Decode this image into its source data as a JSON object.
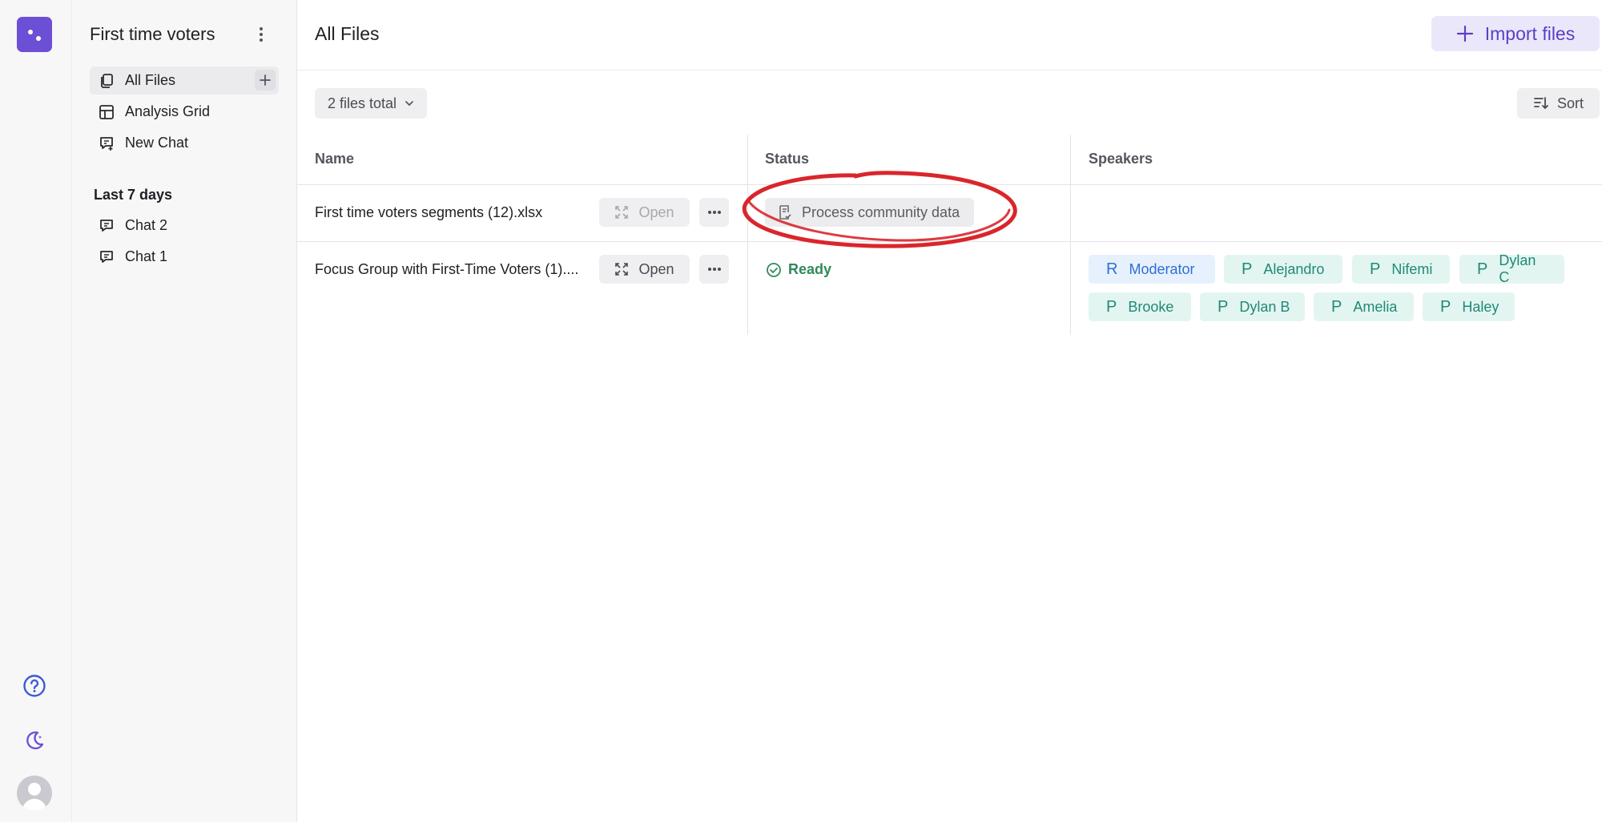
{
  "rail": {
    "icons": [
      "app-logo",
      "help-icon",
      "moon-icon",
      "user-avatar"
    ]
  },
  "sidebar": {
    "project_title": "First time voters",
    "items": [
      {
        "label": "All Files",
        "icon": "files-icon",
        "active": true
      },
      {
        "label": "Analysis Grid",
        "icon": "grid-icon",
        "active": false
      },
      {
        "label": "New Chat",
        "icon": "chat-plus-icon",
        "active": false
      }
    ],
    "section_label": "Last 7 days",
    "chats": [
      {
        "label": "Chat 2",
        "icon": "chat-icon"
      },
      {
        "label": "Chat 1",
        "icon": "chat-icon"
      }
    ]
  },
  "main": {
    "title": "All Files",
    "import_label": "Import files",
    "files_total": "2 files total",
    "sort_label": "Sort",
    "columns": {
      "name": "Name",
      "status": "Status",
      "speakers": "Speakers"
    },
    "rows": [
      {
        "name": "First time voters segments (12).xlsx",
        "open_label": "Open",
        "open_disabled": true,
        "status": "Process community data",
        "speakers": []
      },
      {
        "name": "Focus Group with First-Time Voters (1)....",
        "open_label": "Open",
        "open_disabled": false,
        "status": "Ready",
        "speakers": [
          {
            "initial": "R",
            "name": "Moderator",
            "role": "moderator"
          },
          {
            "initial": "P",
            "name": "Alejandro",
            "role": "participant"
          },
          {
            "initial": "P",
            "name": "Nifemi",
            "role": "participant"
          },
          {
            "initial": "P",
            "name": "Dylan C",
            "role": "participant"
          },
          {
            "initial": "P",
            "name": "Brooke",
            "role": "participant"
          },
          {
            "initial": "P",
            "name": "Dylan B",
            "role": "participant"
          },
          {
            "initial": "P",
            "name": "Amelia",
            "role": "participant"
          },
          {
            "initial": "P",
            "name": "Haley",
            "role": "participant"
          }
        ]
      }
    ]
  },
  "colors": {
    "brand": "#6d4fd6",
    "annotation": "#d9262b",
    "ready": "#2f8a5b",
    "moderator_chip": "#2f6fd6",
    "participant_chip": "#1f8a76"
  }
}
